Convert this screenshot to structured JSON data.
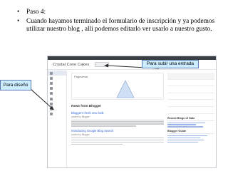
{
  "bullets": [
    {
      "text": "Paso 4:"
    },
    {
      "text": "Cuando hayamos terminado el formulario de inscripción y ya podemos utilizar nuestro blog , allí podemos editarlo ver usarlo  a nuestro gusto."
    }
  ],
  "callouts": {
    "entrada": "Para subir una entrada",
    "diseno": "Para diseño"
  },
  "dashboard": {
    "title": "Crystal Cove Cakes",
    "pageviews_label": "Pageviews",
    "news_heading": "News from Blogger",
    "posts": [
      {
        "title": "Blogger's fresh new look",
        "meta": "posted by Blogger"
      },
      {
        "title": "Introducing Google Blog Search",
        "meta": "posted by Blogger"
      }
    ],
    "blogs_heading": "Recent Blogs of Note",
    "guides_heading": "Blogger Guide"
  },
  "colors": {
    "callout_fill": "#ccecff",
    "callout_border": "#5e7bb5",
    "arrow": "#2e2e2e",
    "link": "#3367d6"
  }
}
